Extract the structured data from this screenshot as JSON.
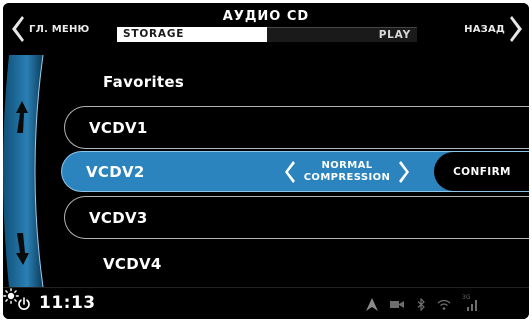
{
  "header": {
    "left_label": "ГЛ. МЕНЮ",
    "title": "АУДИО CD",
    "right_label": "НАЗАД",
    "tabs": [
      {
        "label": "STORAGE",
        "active": true
      },
      {
        "label": "PLAY",
        "active": false
      }
    ]
  },
  "list": {
    "items": [
      {
        "label": "Favorites"
      },
      {
        "label": "VCDV1"
      },
      {
        "label": "VCDV2",
        "selected": true
      },
      {
        "label": "VCDV3"
      },
      {
        "label": "VCDV4"
      }
    ],
    "selected_option": {
      "line1": "NORMAL",
      "line2": "COMPRESSION"
    },
    "confirm_label": "CONFIRM"
  },
  "status_bar": {
    "time": "11:13",
    "signal_label": "3G",
    "icons": [
      "power-icon",
      "navigation-arrow-icon",
      "media-icon",
      "bluetooth-icon",
      "wifi-icon",
      "signal-icon",
      "brightness-icon"
    ]
  },
  "colors": {
    "background": "#000000",
    "selected_row": "#2b84be",
    "scroll_arc": "#1f6f9e",
    "tab_active": "#ffffff"
  }
}
